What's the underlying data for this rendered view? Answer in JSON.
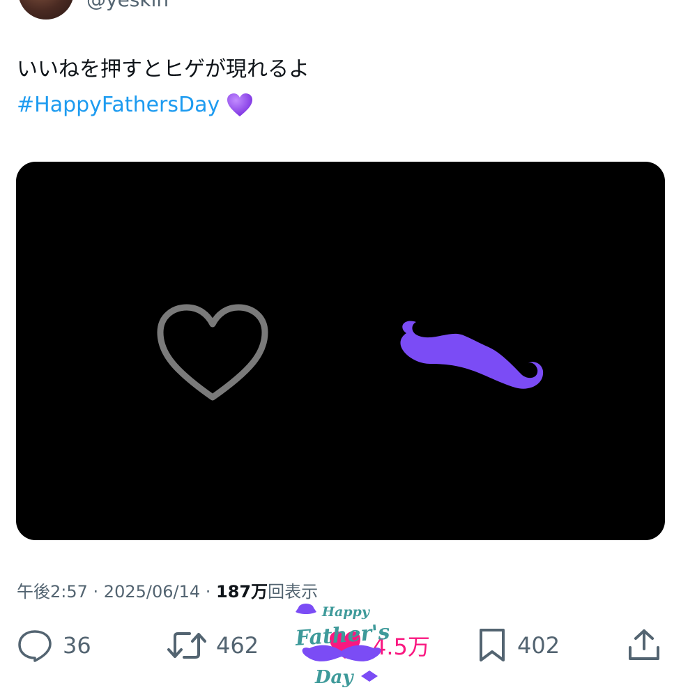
{
  "author": {
    "handle": "@yeskin"
  },
  "tweet": {
    "text": "いいねを押すとヒゲが現れるよ",
    "hashtag": "#HappyFathersDay",
    "emoji": "purple-heart-emoji"
  },
  "media": {
    "background": "#000000",
    "heart_color": "#7a7a7a",
    "mustache_color": "#7b4cf5"
  },
  "meta": {
    "time": "午後2:57",
    "separator": " · ",
    "date": "2025/06/14",
    "views_count": "187万",
    "views_label": "回表示"
  },
  "actions": {
    "replies": "36",
    "reposts": "462",
    "likes": "4.5万",
    "bookmarks": "402"
  },
  "sticker": {
    "line1": "Happy",
    "line2": "Father's",
    "line3": "Day"
  },
  "colors": {
    "accent_blue": "#1d9bf0",
    "like_pink": "#f91880",
    "muted": "#536471",
    "mustache_purple": "#7b4cf5",
    "sticker_teal": "#3e9a9a"
  }
}
